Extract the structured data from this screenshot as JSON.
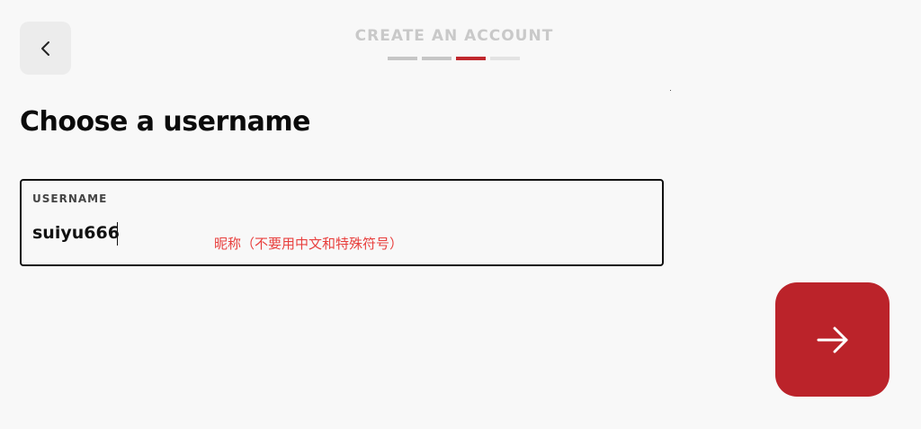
{
  "header": {
    "title": "CREATE AN ACCOUNT",
    "back_icon": "chevron-left-icon",
    "progress": {
      "total_steps": 4,
      "current_step": 3
    }
  },
  "main": {
    "title": "Choose a username",
    "username_field": {
      "label": "USERNAME",
      "value": "suiyu666"
    },
    "annotation": "昵称（不要用中文和特殊符号）"
  },
  "next_button": {
    "icon": "arrow-right-icon"
  },
  "colors": {
    "accent": "#bb232a",
    "progress_active": "#c0272d",
    "progress_done": "#c6c6c6",
    "progress_upcoming": "#e3e3e3",
    "annotation": "#e8403e",
    "background": "#f8f8f8"
  }
}
